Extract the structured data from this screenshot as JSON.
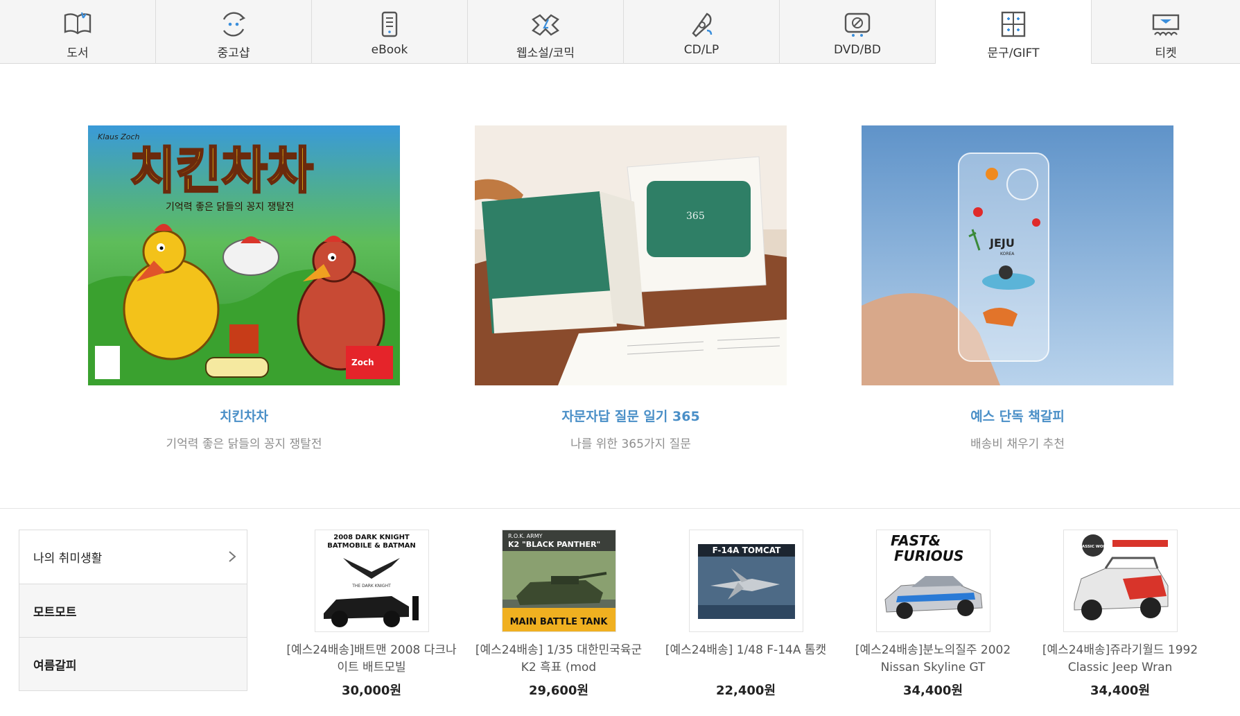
{
  "nav": {
    "categories": [
      {
        "label": "도서",
        "icon": "book-icon"
      },
      {
        "label": "중고샵",
        "icon": "used-shop-icon"
      },
      {
        "label": "eBook",
        "icon": "ebook-icon"
      },
      {
        "label": "웹소설/코믹",
        "icon": "webnovel-comic-icon"
      },
      {
        "label": "CD/LP",
        "icon": "cd-lp-icon"
      },
      {
        "label": "DVD/BD",
        "icon": "dvd-bd-icon"
      },
      {
        "label": "문구/GIFT",
        "icon": "gift-icon"
      },
      {
        "label": "티켓",
        "icon": "ticket-icon"
      }
    ],
    "active": "문구/GIFT"
  },
  "features": [
    {
      "title": "치킨차차",
      "subtitle": "기억력 좋은 닭들의 꽁지 쟁탈전",
      "image": {
        "author": "Klaus Zoch",
        "logo_text": "치킨차차",
        "brand": "Zoch zum Spielen",
        "tagline": "기억력 좋은 닭들의 꽁지 쟁탈전"
      }
    },
    {
      "title": "자문자답 질문 일기 365",
      "subtitle": "나를 위한 365가지 질문",
      "image": {
        "cover_number": "365"
      }
    },
    {
      "title": "예스 단독 책갈피",
      "subtitle": "배송비 채우기 추천",
      "image": {
        "place": "JEJU",
        "place_sub": "KOREA"
      }
    }
  ],
  "sidebar": {
    "items": [
      {
        "label": "나의 취미생활"
      },
      {
        "label": "모트모트"
      },
      {
        "label": "여름갈피"
      }
    ]
  },
  "products": [
    {
      "name": "[예스24배송]배트맨 2008 다크나이트 배트모빌",
      "price": "30,000원",
      "image_text": [
        "2008 DARK KNIGHT",
        "BATMOBILE & BATMAN",
        "THE DARK KNIGHT"
      ]
    },
    {
      "name": "[예스24배송] 1/35 대한민국육군 K2 흑표 (mod",
      "price": "29,600원",
      "image_text": [
        "R.O.K. ARMY",
        "K2 \"BLACK PANTHER\"",
        "MAIN BATTLE TANK"
      ]
    },
    {
      "name": "[예스24배송] 1/48 F-14A 톰캣",
      "price": "22,400원",
      "image_text": [
        "F-14A TOMCAT"
      ]
    },
    {
      "name": "[예스24배송]분노의질주 2002 Nissan Skyline GT",
      "price": "34,400원",
      "image_text": [
        "FAST&",
        "FURIOUS"
      ]
    },
    {
      "name": "[예스24배송]쥬라기월드 1992 Classic Jeep Wran",
      "price": "34,400원",
      "image_text": [
        "JURASSIC WORLD"
      ]
    }
  ],
  "colors": {
    "accent_title": "#4a8fc7",
    "subtitle": "#8e8e8e",
    "nav_bg": "#f5f5f5"
  }
}
